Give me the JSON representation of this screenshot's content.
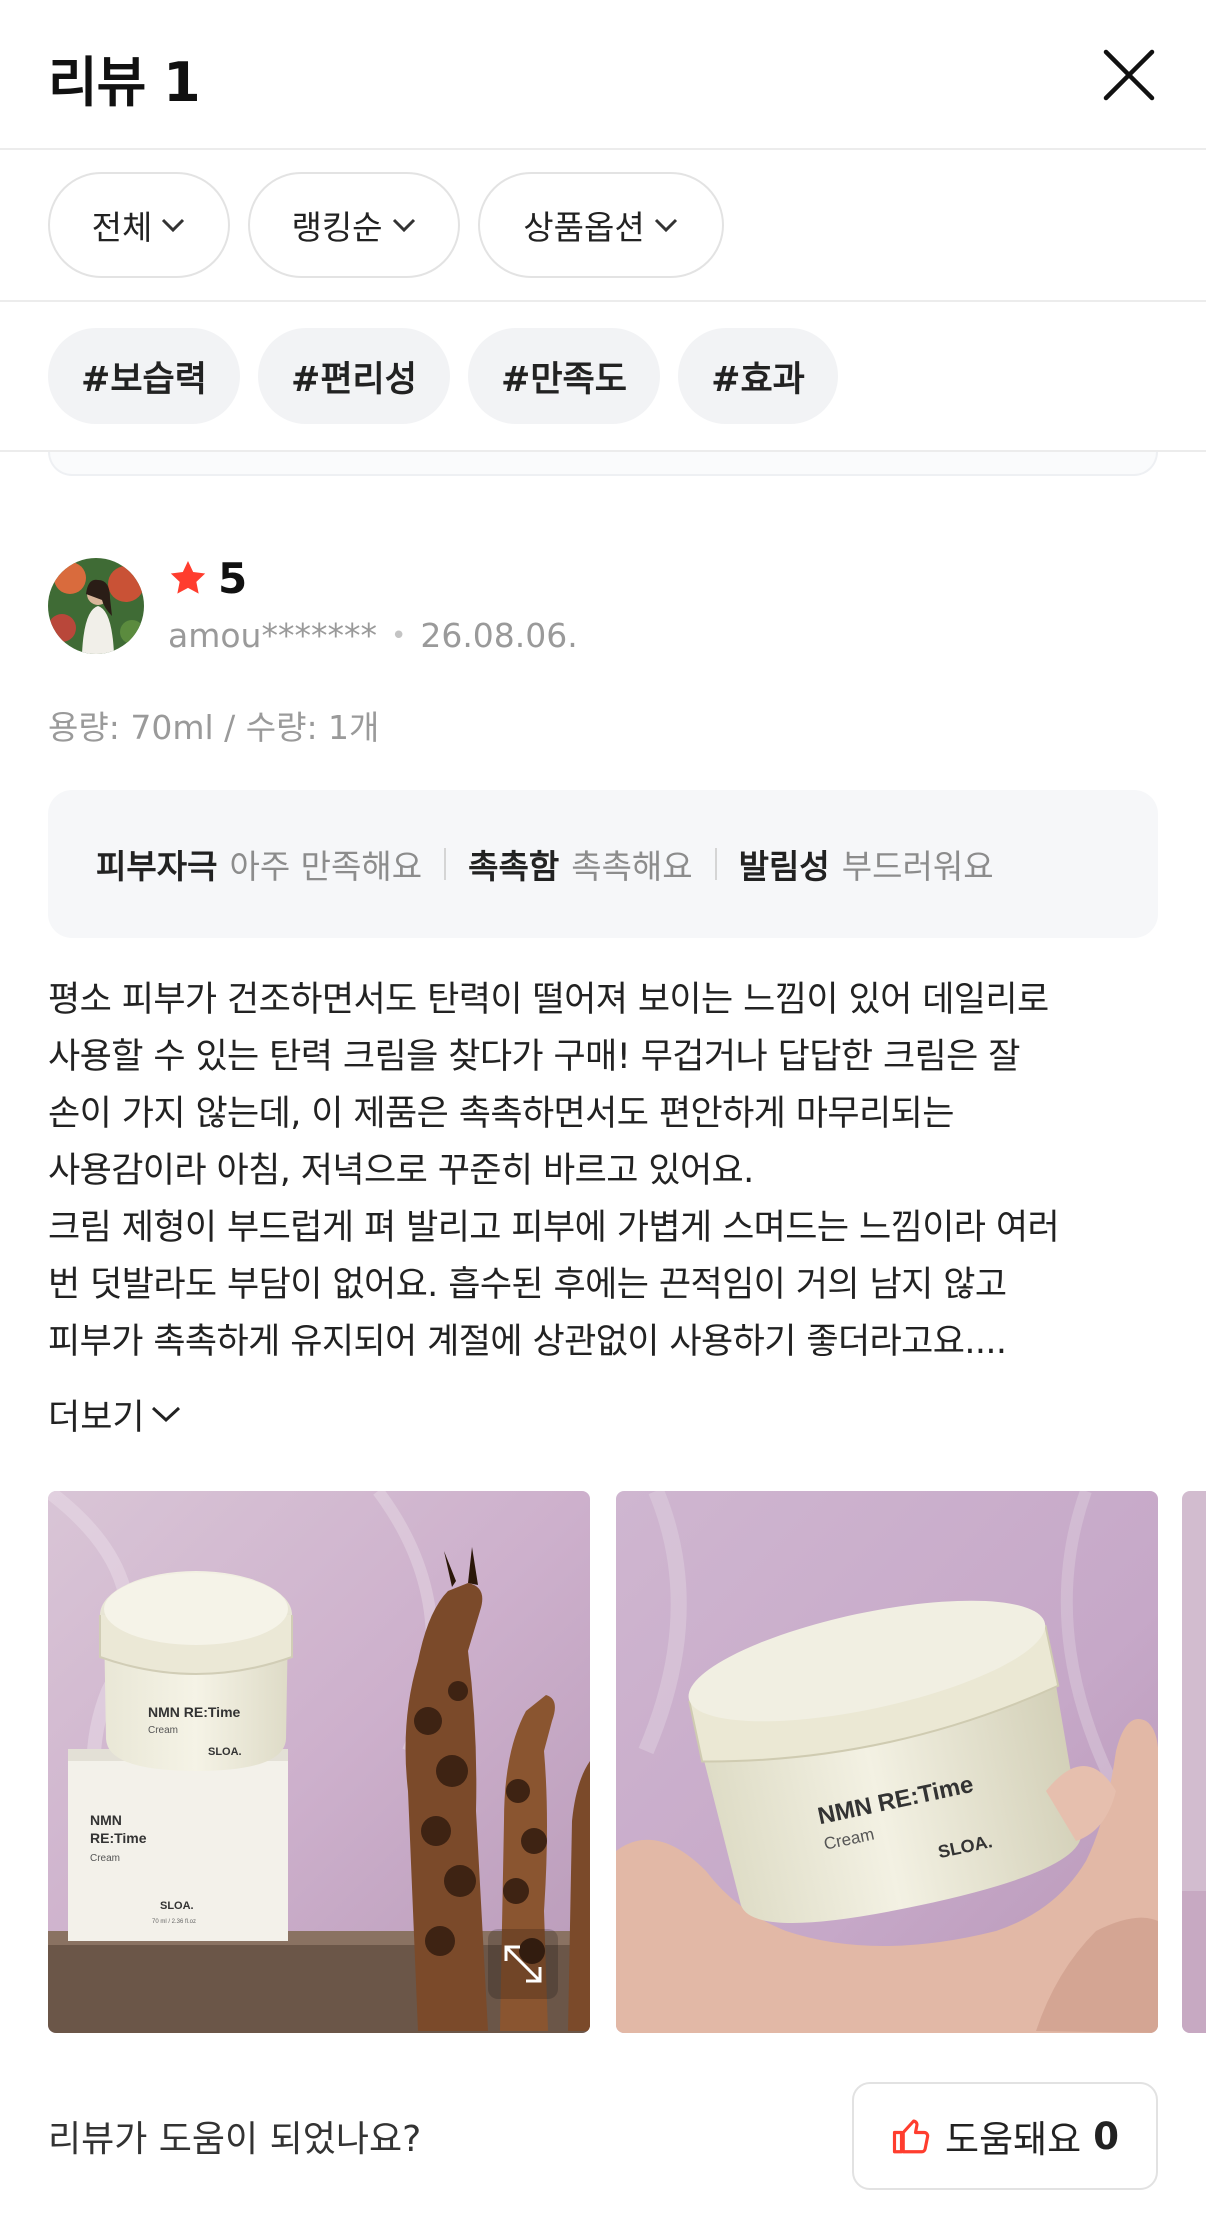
{
  "header": {
    "title": "리뷰 1"
  },
  "filters": [
    {
      "label": "전체"
    },
    {
      "label": "랭킹순"
    },
    {
      "label": "상품옵션"
    }
  ],
  "tags": [
    "#보습력",
    "#편리성",
    "#만족도",
    "#효과"
  ],
  "review": {
    "rating": "5",
    "user": "amou*******",
    "date": "26.08.06.",
    "option": "용량: 70ml / 수량: 1개",
    "evaluations": [
      {
        "key": "피부자극",
        "value": "아주 만족해요"
      },
      {
        "key": "촉촉함",
        "value": "촉촉해요"
      },
      {
        "key": "발림성",
        "value": "부드러워요"
      }
    ],
    "text_lines": [
      "평소 피부가 건조하면서도 탄력이 떨어져 보이는 느낌이 있어 데일리로",
      "사용할 수 있는 탄력 크림을 찾다가 구매! 무겁거나 답답한 크림은 잘",
      "손이 가지 않는데, 이 제품은 촉촉하면서도 편안하게 마무리되는",
      "사용감이라 아침, 저녁으로 꾸준히 바르고 있어요.",
      "크림 제형이 부드럽게 펴 발리고 피부에 가볍게 스며드는 느낌이라 여러",
      "번 덧발라도 부담이 없어요. 흡수된 후에는 끈적임이 거의 남지 않고",
      "피부가 촉촉하게 유지되어 계절에 상관없이 사용하기 좋더라고요...."
    ],
    "more_label": "더보기",
    "product": {
      "line1": "NMN RE:Time",
      "line2": "Cream",
      "brand": "SLOA.",
      "box_line1": "NMN",
      "box_line2": "RE:Time",
      "box_line3": "Cream",
      "box_brand": "SLOA.",
      "box_small": "70 ml / 2.36 fl.oz"
    }
  },
  "helpful": {
    "question": "리뷰가 도움이 되었나요?",
    "button_label": "도움돼요",
    "count": "0"
  },
  "colors": {
    "star": "#ff3d2e",
    "thumb": "#ff3d2e"
  }
}
